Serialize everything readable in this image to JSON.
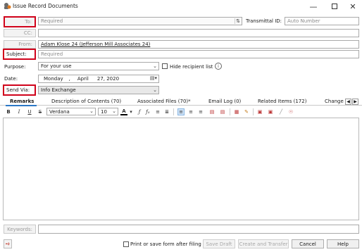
{
  "window": {
    "title": "Issue Record Documents"
  },
  "form": {
    "to_label": "To:",
    "to_placeholder": "Required",
    "transmittal_label": "Transmittal ID:",
    "transmittal_placeholder": "Auto Number",
    "cc_label": "CC:",
    "from_label": "From:",
    "from_value": "Adam Klose 24 (Jefferson Mill Associates 24)",
    "subject_label": "Subject:",
    "subject_placeholder": "Required",
    "purpose_label": "Purpose:",
    "purpose_value": "For your use",
    "hide_recipient_label": "Hide recipient list",
    "date_label": "Date:",
    "date_weekday": "Monday",
    "date_sep": ",",
    "date_month": "April",
    "date_day_year": "27, 2020",
    "send_via_label": "Send Via:",
    "send_via_value": "Info Exchange"
  },
  "tabs": [
    {
      "label": "Remarks",
      "active": true
    },
    {
      "label": "Description of Contents (70)"
    },
    {
      "label": "Associated Files (70)*"
    },
    {
      "label": "Email Log (0)"
    },
    {
      "label": "Related Items (172)"
    },
    {
      "label": "Change"
    }
  ],
  "toolbar": {
    "bold": "B",
    "italic": "I",
    "underline": "U",
    "strike": "S",
    "font": "Verdana",
    "size": "10",
    "color_letter": "A"
  },
  "footer": {
    "keywords_label": "Keywords:",
    "print_checkbox_label": "Print or save form after filing",
    "save_draft": "Save Draft",
    "create_transfer": "Create and Transfer",
    "cancel": "Cancel",
    "help": "Help"
  },
  "colors": {
    "accent": "#2b78c6",
    "highlight_border": "#d0021b"
  }
}
